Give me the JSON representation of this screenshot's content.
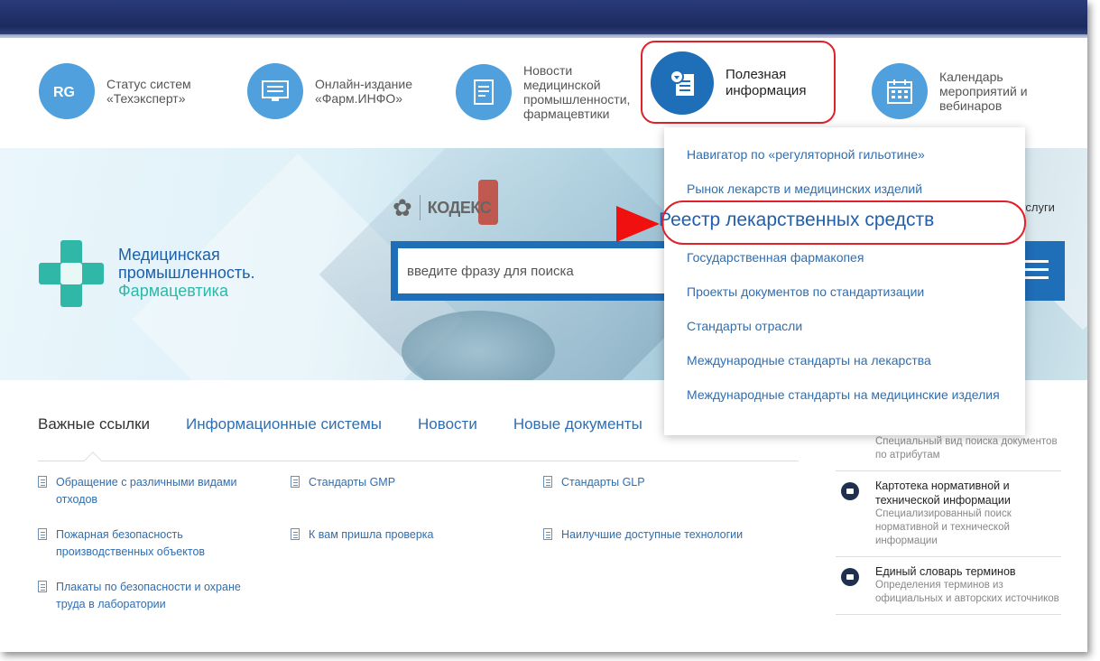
{
  "quick_links": [
    {
      "label": "Статус систем «Техэксперт»",
      "icon": "rg-logo-icon"
    },
    {
      "label": "Онлайн-издание «Фарм.ИНФО»",
      "icon": "monitor-icon"
    },
    {
      "label": "Новости медицинской промышленности, фармацевтики",
      "icon": "document-icon"
    },
    {
      "label": "Полезная информация",
      "icon": "info-document-icon"
    },
    {
      "label": "Календарь мероприятий и вебинаров",
      "icon": "calendar-icon"
    }
  ],
  "logo": {
    "line1": "Медицинская",
    "line2": "промышленность.",
    "line3": "Фармацевтика"
  },
  "kodeks": {
    "name": "КОДЕКС"
  },
  "search": {
    "placeholder": "введите фразу для поиска"
  },
  "uslugi_label": "услуги",
  "tabs": [
    "Важные ссылки",
    "Информационные системы",
    "Новости",
    "Новые документы"
  ],
  "links": [
    "Обращение с различными видами отходов",
    "Стандарты GMP",
    "Стандарты GLP",
    "Пожарная безопасность производственных объектов",
    "К вам пришла проверка",
    "Наилучшие доступные технологии",
    "Плакаты по безопасности и охране труда в лаборатории"
  ],
  "right_column": [
    {
      "title": "",
      "desc": "Специальный вид поиска документов по атрибутам"
    },
    {
      "title": "Картотека нормативной и технической информации",
      "desc": "Специализированный поиск нормативной и технической информации"
    },
    {
      "title": "Единый словарь терминов",
      "desc": "Определения терминов из официальных и авторских источников"
    }
  ],
  "dropdown": [
    "Навигатор по «регуляторной гильотине»",
    "Рынок лекарств и медицинских изделий",
    "Реестр лекарственных средств",
    "Государственная фармакопея",
    "Проекты документов по стандартизации",
    "Стандарты отрасли",
    "Международные стандарты на лекарства",
    "Международные стандарты на медицинские изделия"
  ],
  "colors": {
    "accent": "#1f6eb8",
    "link": "#2f6eb0",
    "teal": "#2fb7a8",
    "highlight": "#e0202a"
  }
}
